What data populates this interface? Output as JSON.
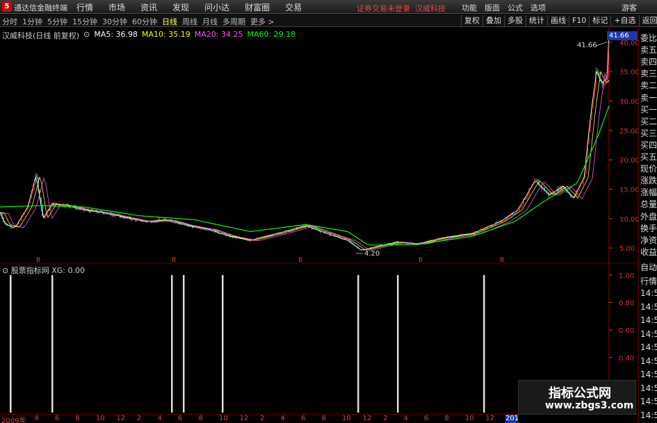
{
  "topbar": {
    "logo_glyph": "5",
    "app_title": "通达信金融终端",
    "menu": [
      "行情",
      "市场",
      "资讯",
      "发现",
      "问小达",
      "财富圈",
      "交易"
    ],
    "login_warning": "证券交易未登录",
    "stock_link": "汉威科技",
    "right_menu": [
      "功能",
      "版面",
      "公式",
      "选项"
    ],
    "guest": "游客"
  },
  "toolbar": {
    "periods": [
      "分时",
      "1分钟",
      "5分钟",
      "15分钟",
      "30分钟",
      "60分钟",
      "日线",
      "周线",
      "月线",
      "多周期",
      "更多 >"
    ],
    "selected_period": "日线",
    "right_tools": [
      "复权",
      "叠加",
      "多股",
      "统计",
      "画线",
      "F10",
      "标记",
      "+自选",
      "返回"
    ]
  },
  "chart_info": {
    "stock_label": "汉威科技(日线 前复权)",
    "ma5": "MA5: 36.98",
    "ma10": "MA10: 35.19",
    "ma20": "MA20: 34.25",
    "ma60": "MA60: 29.18"
  },
  "sub_info": {
    "indicator": "股票指标网",
    "xg": "XG: 0.00"
  },
  "current_price": "41.66",
  "max_label": "41.66",
  "min_label": "4.20",
  "right_panel": [
    "委比",
    "卖五",
    "卖四",
    "卖三",
    "卖二",
    "卖一",
    "买一",
    "买二",
    "买三",
    "买四",
    "买五",
    "现价",
    "涨跌",
    "涨幅",
    "总量",
    "外盘",
    "换手",
    "净资",
    "收益",
    "自动",
    "行情",
    "14:50",
    "14:50",
    "14:50",
    "14:50",
    "14:50",
    "14:50",
    "14:50",
    "14:50",
    "14:50",
    "14:5"
  ],
  "watermark": {
    "line1": "指标公式网",
    "line2": "www.zbgs3.com"
  },
  "x_labels": [
    "2009年",
    "4",
    "6",
    "8",
    "10",
    "12",
    "2",
    "4",
    "6",
    "8",
    "10",
    "12",
    "2",
    "4",
    "6",
    "8",
    "10",
    "12",
    "2",
    "4",
    "6",
    "8",
    "10",
    "12",
    "5"
  ],
  "year_box": "201",
  "colors": {
    "up": "#ff4040",
    "down": "#55ffff",
    "ma5": "#ffffff",
    "ma10": "#ffff00",
    "ma20": "#ff55ff",
    "ma60": "#00ff00",
    "axis": "#ff4040"
  },
  "chart_data": {
    "type": "line",
    "title": "汉威科技(日线 前复权)",
    "y_axis_main": [
      5.0,
      10.0,
      15.0,
      20.0,
      25.0,
      30.0,
      35.0,
      40.0
    ],
    "ylim_main": [
      3,
      42
    ],
    "y_axis_sub": [
      0.2,
      0.4,
      0.6,
      0.8,
      1.0
    ],
    "ylim_sub": [
      0,
      1.05
    ],
    "price_anchors": [
      [
        0,
        11
      ],
      [
        8,
        9
      ],
      [
        22,
        8.5
      ],
      [
        40,
        12
      ],
      [
        52,
        17.5
      ],
      [
        62,
        10
      ],
      [
        75,
        12.5
      ],
      [
        95,
        12.3
      ],
      [
        120,
        11.5
      ],
      [
        150,
        11
      ],
      [
        180,
        10.2
      ],
      [
        210,
        9.5
      ],
      [
        240,
        9.8
      ],
      [
        270,
        8.8
      ],
      [
        300,
        8.2
      ],
      [
        330,
        7
      ],
      [
        360,
        6.3
      ],
      [
        400,
        7.5
      ],
      [
        440,
        8.8
      ],
      [
        470,
        7.5
      ],
      [
        500,
        6.3
      ],
      [
        520,
        4.6
      ],
      [
        540,
        5.2
      ],
      [
        570,
        6
      ],
      [
        600,
        5.7
      ],
      [
        640,
        6.8
      ],
      [
        680,
        7.5
      ],
      [
        700,
        8.5
      ],
      [
        720,
        9.5
      ],
      [
        745,
        11.5
      ],
      [
        770,
        16.5
      ],
      [
        790,
        14
      ],
      [
        810,
        15.5
      ],
      [
        825,
        13.5
      ],
      [
        840,
        17
      ],
      [
        850,
        28
      ],
      [
        858,
        35
      ],
      [
        866,
        33
      ],
      [
        873,
        34
      ],
      [
        876,
        41.66
      ]
    ],
    "ma60_anchors": [
      [
        0,
        12
      ],
      [
        60,
        12.2
      ],
      [
        120,
        12
      ],
      [
        200,
        10.5
      ],
      [
        280,
        9.8
      ],
      [
        360,
        7.8
      ],
      [
        440,
        9
      ],
      [
        500,
        7.8
      ],
      [
        530,
        5.5
      ],
      [
        600,
        5.6
      ],
      [
        680,
        7
      ],
      [
        740,
        9.5
      ],
      [
        790,
        13.5
      ],
      [
        830,
        16
      ],
      [
        860,
        24
      ],
      [
        876,
        29.18
      ]
    ],
    "signals_x": [
      15,
      75,
      247,
      264,
      320,
      515,
      572,
      696
    ],
    "signal_value": 1,
    "markers_x": [
      55,
      250,
      432,
      605,
      722
    ],
    "marker_text": "B"
  }
}
